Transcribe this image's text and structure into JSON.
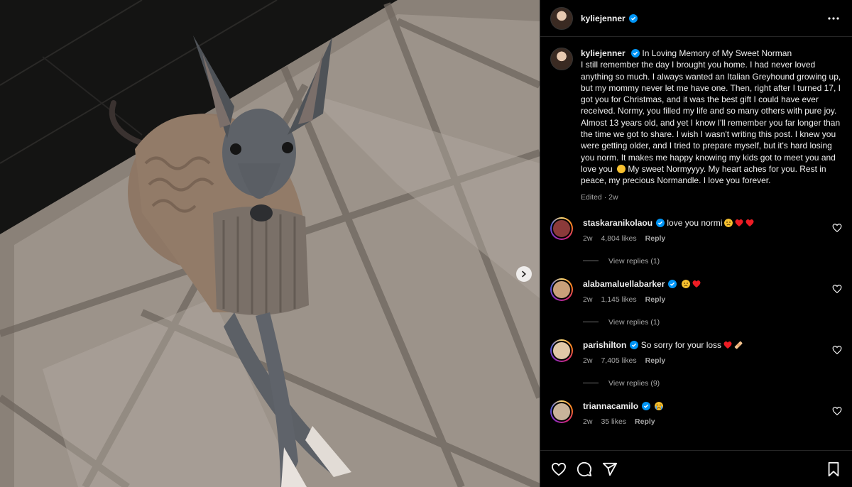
{
  "post": {
    "username": "kyliejenner",
    "caption_title": "In Loving Memory of My Sweet Norman",
    "caption_body": "I still remember the day I brought you home. I had never loved anything so much. I always wanted an Italian Greyhound growing up, but my mommy never let me have one. Then, right after I turned 17, I got you for Christmas, and it was the best gift I could have ever received. Normy, you filled my life and so many others with pure joy. Almost 13 years old, and yet I know I'll remember you far longer than the time we got to share. I wish I wasn't writing this post. I knew you were getting older, and I tried to prepare myself, but it's hard losing you norm. It makes me happy knowing my kids got to meet you and love you",
    "caption_tail": "My sweet Normyyyy. My heart aches for you. Rest in peace, my precious Normandle. I love you forever.",
    "edited": "Edited · 2w"
  },
  "comments": [
    {
      "username": "staskaranikolaou",
      "text": "love you normi",
      "emojis": [
        "sad",
        "heart",
        "heart"
      ],
      "age": "2w",
      "likes": "4,804 likes",
      "reply": "Reply",
      "view_replies": "View replies (1)"
    },
    {
      "username": "alabamaluellabarker",
      "text": "",
      "emojis": [
        "sad",
        "heart"
      ],
      "age": "2w",
      "likes": "1,145 likes",
      "reply": "Reply",
      "view_replies": "View replies (1)"
    },
    {
      "username": "parishilton",
      "text": "So sorry for your loss",
      "emojis": [
        "heart",
        "bandage"
      ],
      "age": "2w",
      "likes": "7,405 likes",
      "reply": "Reply",
      "view_replies": "View replies (9)"
    },
    {
      "username": "triannacamilo",
      "text": "",
      "emojis": [
        "cry"
      ],
      "age": "2w",
      "likes": "35 likes",
      "reply": "Reply",
      "view_replies": ""
    }
  ],
  "icons": {
    "more": "more-horizontal-icon",
    "next": "chevron-right-icon",
    "like": "heart-outline-icon",
    "comment": "comment-icon",
    "share": "paper-plane-icon",
    "save": "bookmark-icon",
    "verified": "verified-badge-icon"
  },
  "colors": {
    "background": "#000000",
    "text": "#f5f5f5",
    "muted": "#a8a8a8",
    "verified": "#0095f6",
    "heart": "#ed1c24"
  }
}
